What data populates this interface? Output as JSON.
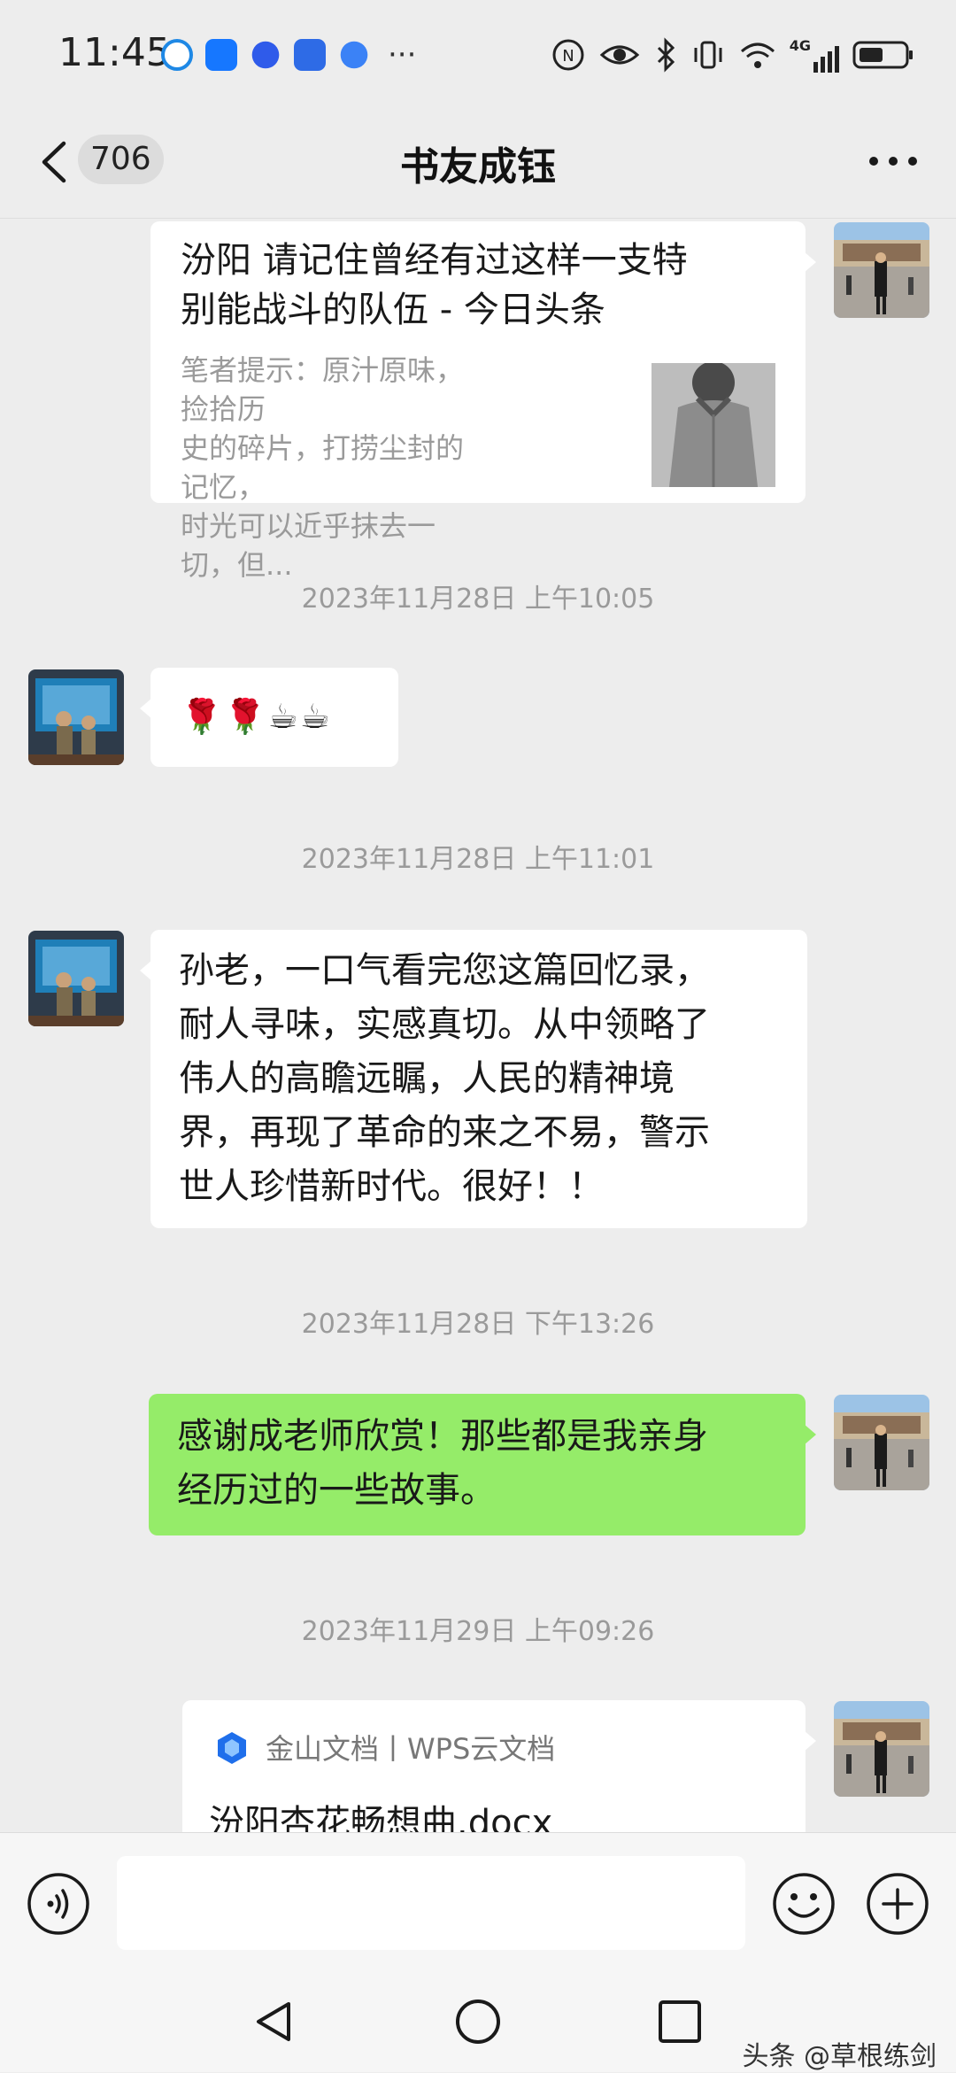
{
  "status_bar": {
    "time": "11:45",
    "network": "4G",
    "more_label": "···"
  },
  "header": {
    "back_count": "706",
    "title": "书友成钰",
    "more_label": "···"
  },
  "messages": [
    {
      "type": "link",
      "side": "right",
      "title": "汾阳 请记住曾经有过这样一支特别能战斗的队伍 - 今日头条",
      "title_line1": "汾阳 请记住曾经有过这样一支特",
      "title_line2": "别能战斗的队伍 - 今日头条",
      "description": "笔者提示：原汁原味，捡拾历史的碎片，打捞尘封的记忆，时光可以近乎抹去一切，但...",
      "desc_line1": "笔者提示：原汁原味，捡拾历",
      "desc_line2": "史的碎片，打捞尘封的记忆，",
      "desc_line3": "时光可以近乎抹去一切，但..."
    },
    {
      "type": "timestamp",
      "text": "2023年11月28日 上午10:05"
    },
    {
      "type": "text",
      "side": "left",
      "text": "🌹🌹☕☕"
    },
    {
      "type": "timestamp",
      "text": "2023年11月28日 上午11:01"
    },
    {
      "type": "text",
      "side": "left",
      "text": "孙老，一口气看完您这篇回忆录，耐人寻味，实感真切。从中领略了伟人的高瞻远瞩，人民的精神境界，再现了革命的来之不易，警示世人珍惜新时代。很好！！",
      "lines": [
        "孙老，一口气看完您这篇回忆录，",
        "耐人寻味，实感真切。从中领略了",
        "伟人的高瞻远瞩，人民的精神境",
        "界，再现了革命的来之不易，警示",
        "世人珍惜新时代。很好！！"
      ]
    },
    {
      "type": "timestamp",
      "text": "2023年11月28日 下午13:26"
    },
    {
      "type": "text",
      "side": "right",
      "bubble_color": "#95ec69",
      "text": "感谢成老师欣赏！那些都是我亲身经历过的一些故事。",
      "lines": [
        "感谢成老师欣赏！那些都是我亲身",
        "经历过的一些故事。"
      ]
    },
    {
      "type": "timestamp",
      "text": "2023年11月29日 上午09:26"
    },
    {
      "type": "file",
      "side": "right",
      "source": "金山文档丨WPS云文档",
      "title": "汾阳杏花畅想曲.docx"
    }
  ],
  "input_bar": {
    "voice_icon": "voice-icon",
    "emoji_icon": "emoji-icon",
    "plus_icon": "plus-icon"
  },
  "watermark": "头条 @草根练剑",
  "colors": {
    "background": "#ededed",
    "bubble_self": "#95ec69",
    "bubble_other": "#ffffff",
    "timestamp": "#9a9a9a"
  }
}
